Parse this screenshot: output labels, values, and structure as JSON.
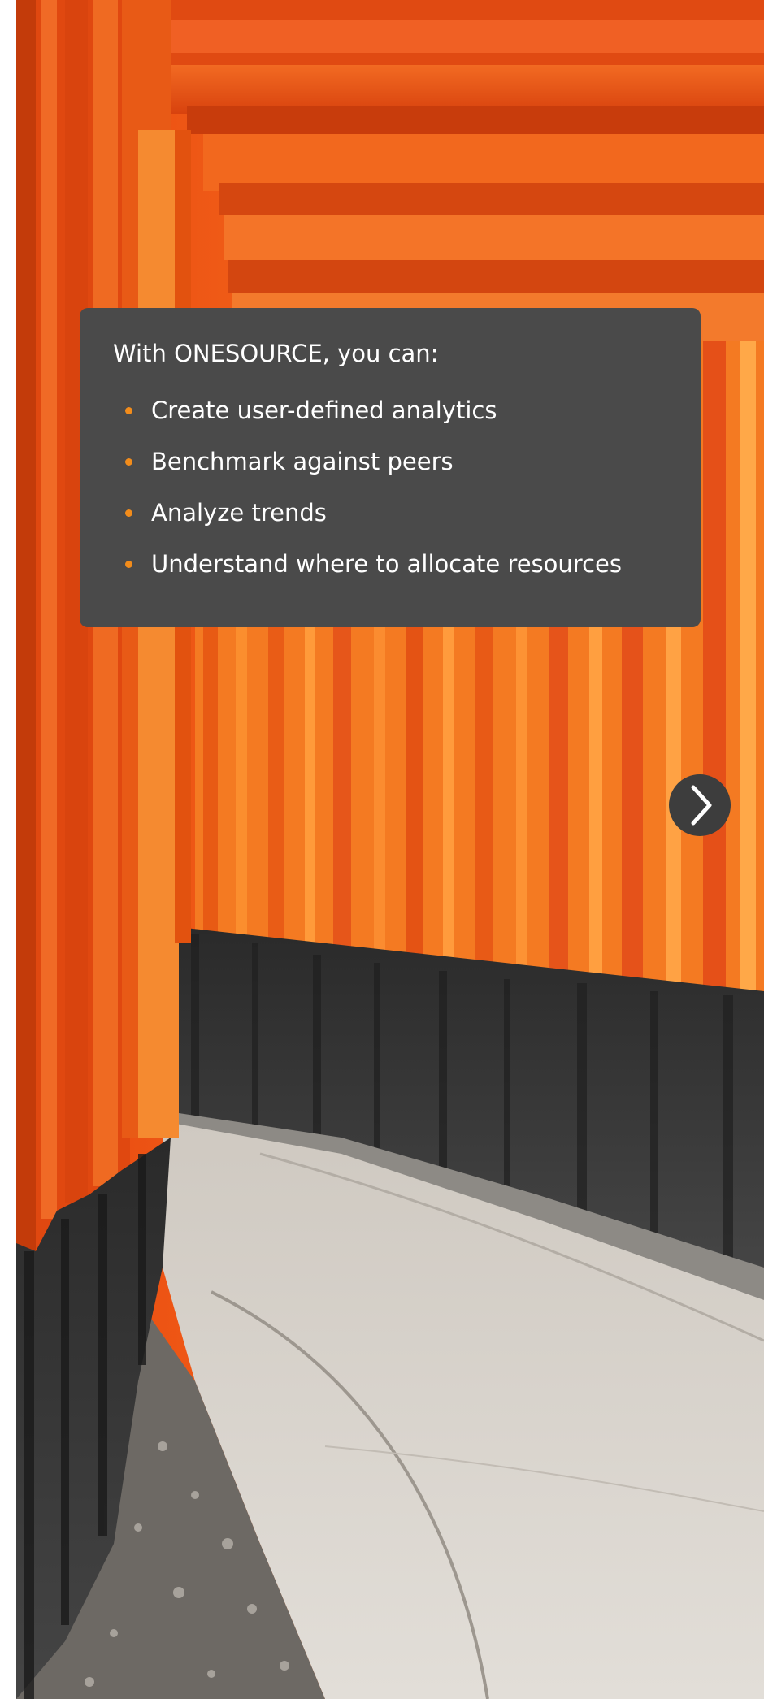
{
  "slide": {
    "card": {
      "heading": "With ONESOURCE, you can:",
      "bullets": [
        "Create user-defined analytics",
        "Benchmark against peers",
        "Analyze trends",
        "Understand where to allocate resources"
      ]
    },
    "next_button": {
      "icon": "chevron-right-icon"
    },
    "photo": {
      "subject": "torii-gate-tunnel-photo"
    }
  },
  "colors": {
    "card_background": "#4a4a4a",
    "bullet_accent": "#f28c1b",
    "gate_orange": "#f0601a",
    "gate_black": "#2e2e2e",
    "path_stone": "#d8d4ce"
  }
}
